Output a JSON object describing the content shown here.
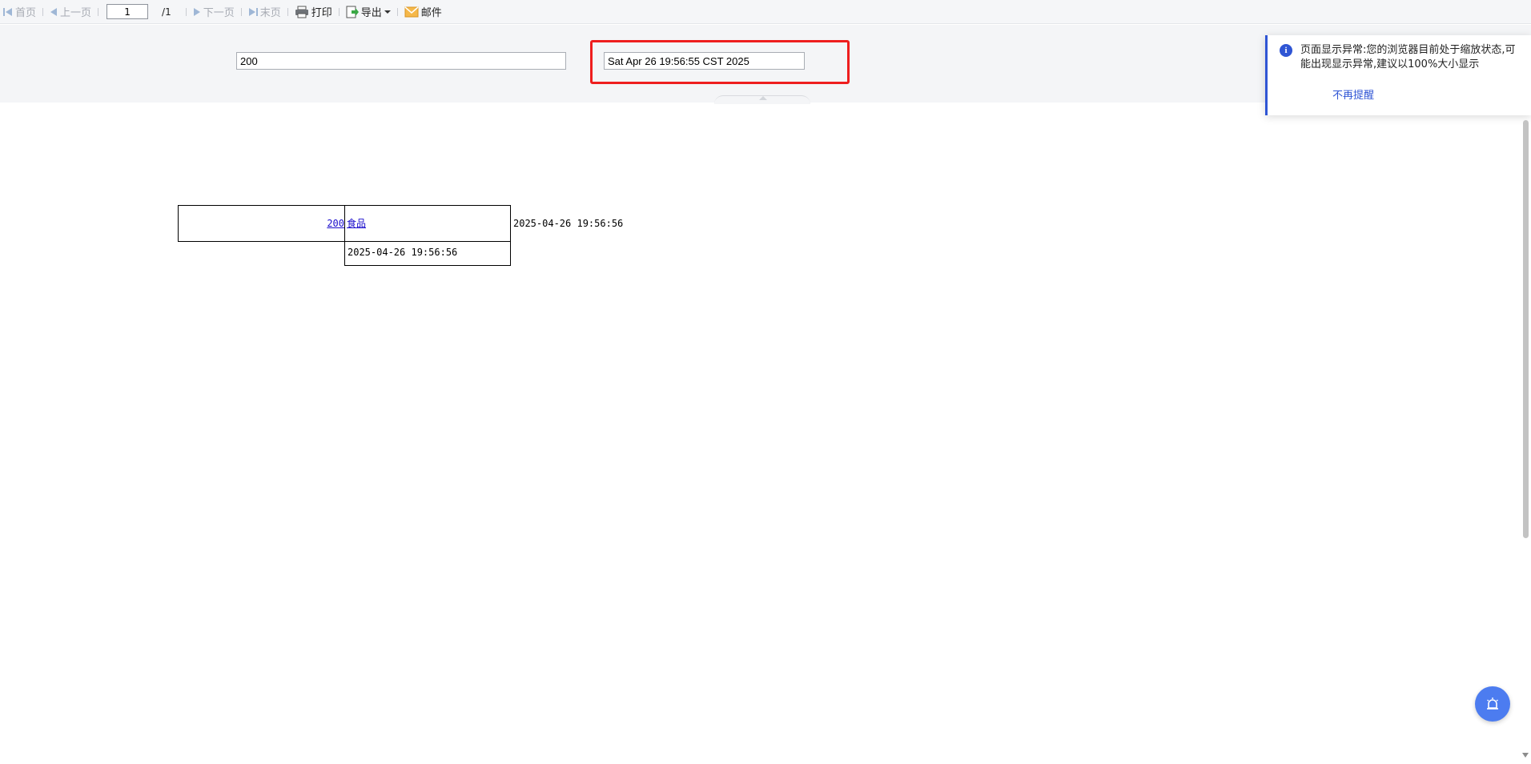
{
  "toolbar": {
    "first_label": "首页",
    "prev_label": "上一页",
    "page_value": "1",
    "page_total": "/1",
    "next_label": "下一页",
    "last_label": "末页",
    "print_label": "打印",
    "export_label": "导出",
    "mail_label": "邮件"
  },
  "params": {
    "value_input": "200",
    "date_input": "Sat Apr 26 19:56:55 CST 2025"
  },
  "report": {
    "id_link": "200",
    "category_link": "食品",
    "timestamp_outside": "2025-04-26 19:56:56",
    "timestamp_cell": "2025-04-26 19:56:56"
  },
  "notice": {
    "message": "页面显示异常:您的浏览器目前处于缩放状态,可能出现显示异常,建议以100%大小显示",
    "dismiss_label": "不再提醒"
  },
  "colors": {
    "accent": "#2f55d4",
    "highlight": "#ee1e1e",
    "fab": "#4c7cf0"
  }
}
